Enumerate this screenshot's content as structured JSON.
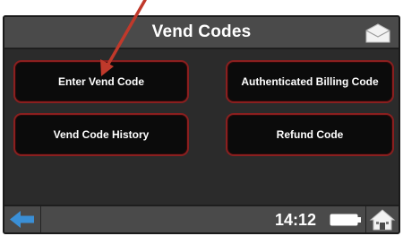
{
  "header": {
    "title": "Vend Codes",
    "icon": "envelope-icon"
  },
  "buttons": {
    "enter_vend_code": "Enter Vend Code",
    "authenticated_billing_code": "Authenticated Billing Code",
    "vend_code_history": "Vend Code History",
    "refund_code": "Refund Code"
  },
  "footer": {
    "time": "14:12",
    "back_icon": "back-arrow-icon",
    "battery_icon": "battery-icon",
    "home_icon": "home-icon"
  },
  "colors": {
    "screen_bg": "#2b2b2b",
    "bar_bg": "#4a4a4a",
    "button_bg": "#0b0b0b",
    "button_border": "#8a1f1f",
    "back_arrow": "#3a8fd6",
    "annotation_arrow": "#c0392b"
  }
}
